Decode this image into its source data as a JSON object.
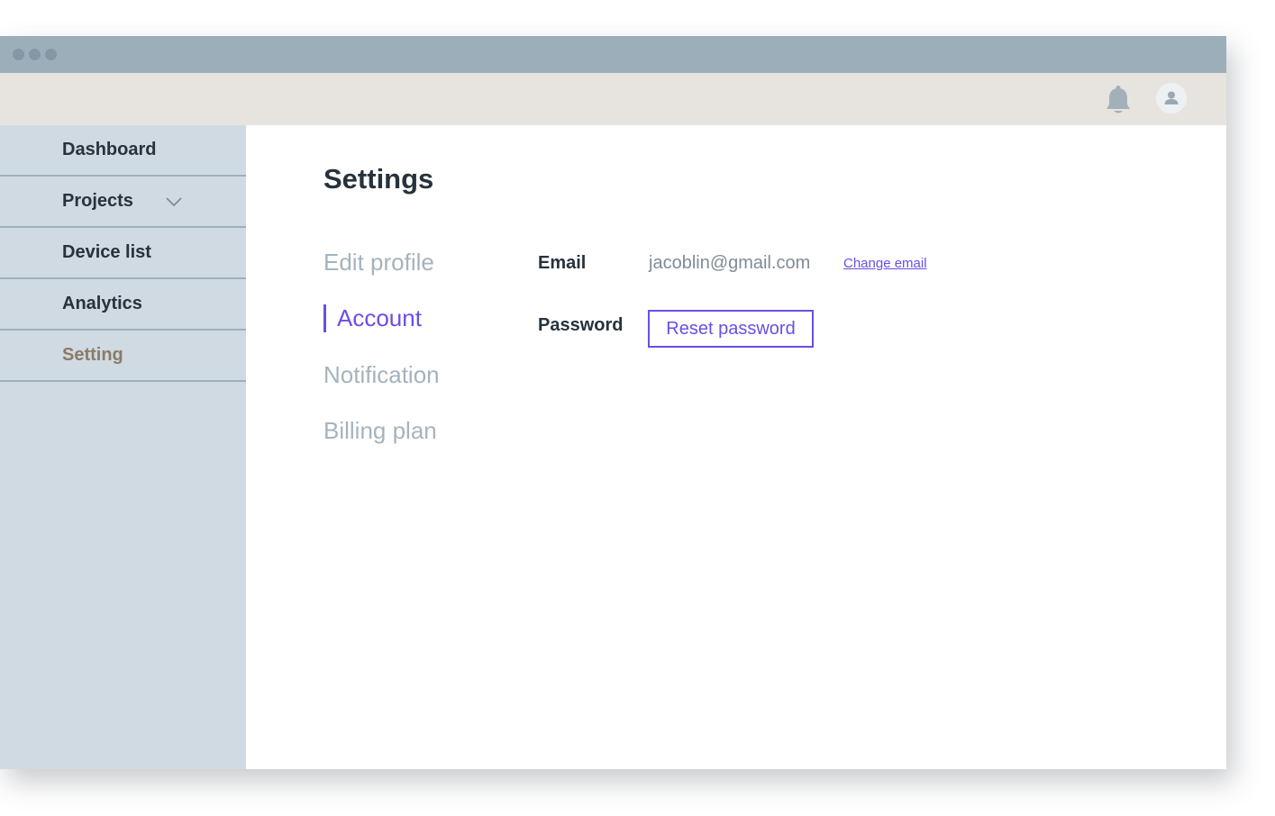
{
  "window": {
    "controls": [
      "window-dot",
      "window-dot",
      "window-dot"
    ]
  },
  "topbar": {
    "icons": [
      "bell-icon",
      "user-avatar-icon"
    ]
  },
  "sidebar": {
    "items": [
      {
        "label": "Dashboard",
        "active": false
      },
      {
        "label": "Projects",
        "active": false,
        "has_dropdown": true
      },
      {
        "label": "Device list",
        "active": false
      },
      {
        "label": "Analytics",
        "active": false
      },
      {
        "label": "Setting",
        "active": true
      }
    ]
  },
  "main": {
    "title": "Settings",
    "subnav": [
      {
        "label": "Edit profile",
        "active": false
      },
      {
        "label": "Account",
        "active": true
      },
      {
        "label": "Notification",
        "active": false
      },
      {
        "label": "Billing plan",
        "active": false
      }
    ],
    "account": {
      "email_label": "Email",
      "email_value": "jacoblin@gmail.com",
      "change_email_label": "Change email",
      "password_label": "Password",
      "reset_password_label": "Reset password"
    }
  },
  "colors": {
    "accent": "#6b4ee6",
    "titlebar": "#9daebb",
    "topbar": "#e7e4e0",
    "sidebar": "#cfdae3",
    "sidebar_active_text": "#8c7a66",
    "text_dark": "#27323c",
    "text_muted": "#a5b3be"
  }
}
